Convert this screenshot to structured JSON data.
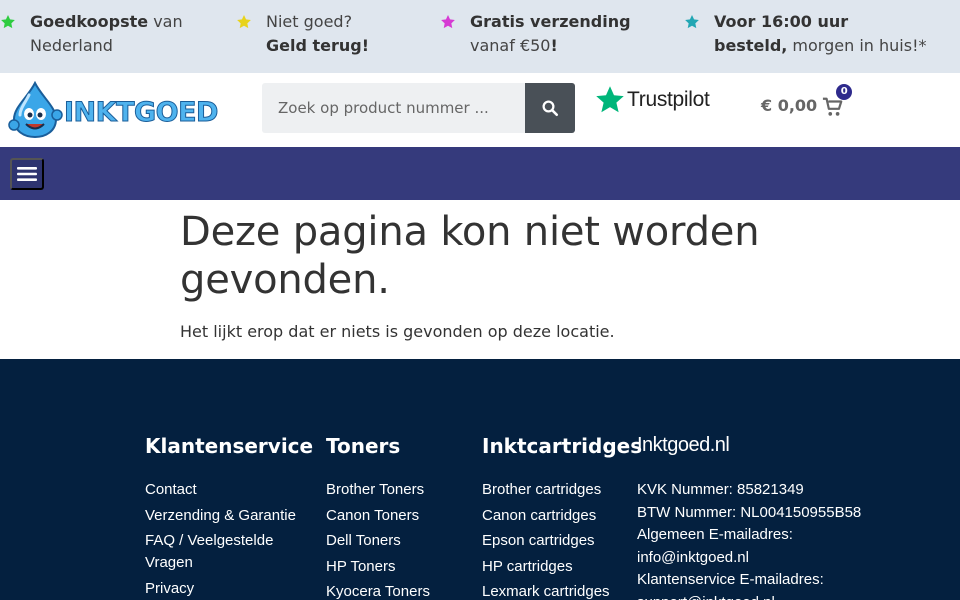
{
  "usps": [
    {
      "icon": "star-icon",
      "color": "#2ecc40",
      "bold1": "Goedkoopste",
      "text1": " van",
      "line2": "Nederland",
      "bold2": ""
    },
    {
      "icon": "star-icon",
      "color": "#e8d31b",
      "text1": "Niet goed?",
      "bold2": "Geld terug!"
    },
    {
      "icon": "star-icon",
      "color": "#d63ad3",
      "bold1": "Gratis verzending",
      "line2": "vanaf €50",
      "bold2": "!"
    },
    {
      "icon": "star-icon",
      "color": "#22a6b3",
      "bold1": "Voor 16:00 uur",
      "bold2": "besteld,",
      "line2": " morgen in huis!*"
    }
  ],
  "header": {
    "logo_text": "INKTGOED",
    "search_placeholder": "Zoek op product nummer ...",
    "trustpilot": "Trustpilot",
    "cart_amount": "€ 0,00",
    "cart_count": "0"
  },
  "main": {
    "title": "Deze pagina kon niet worden gevonden.",
    "text": "Het lijkt erop dat er niets is gevonden op deze locatie."
  },
  "footer": {
    "col1": {
      "title": "Klantenservice",
      "links": [
        "Contact",
        "Verzending & Garantie",
        "FAQ / Veelgestelde Vragen",
        "Privacy"
      ]
    },
    "col2": {
      "title": "Toners",
      "links": [
        "Brother Toners",
        "Canon Toners",
        "Dell Toners",
        "HP Toners",
        "Kyocera Toners"
      ]
    },
    "col3": {
      "title": "Inktcartridges",
      "links": [
        "Brother cartridges",
        "Canon cartridges",
        "Epson cartridges",
        "HP cartridges",
        "Lexmark cartridges"
      ]
    },
    "col4": {
      "title": "Inktgoed.nl",
      "lines": [
        "KVK Nummer: 85821349",
        "BTW Nummer: NL004150955B58",
        "Algemeen E-mailadres:",
        "info@inktgoed.nl",
        "Klantenservice E-mailadres:",
        "support@inktgoed.nl"
      ]
    }
  }
}
